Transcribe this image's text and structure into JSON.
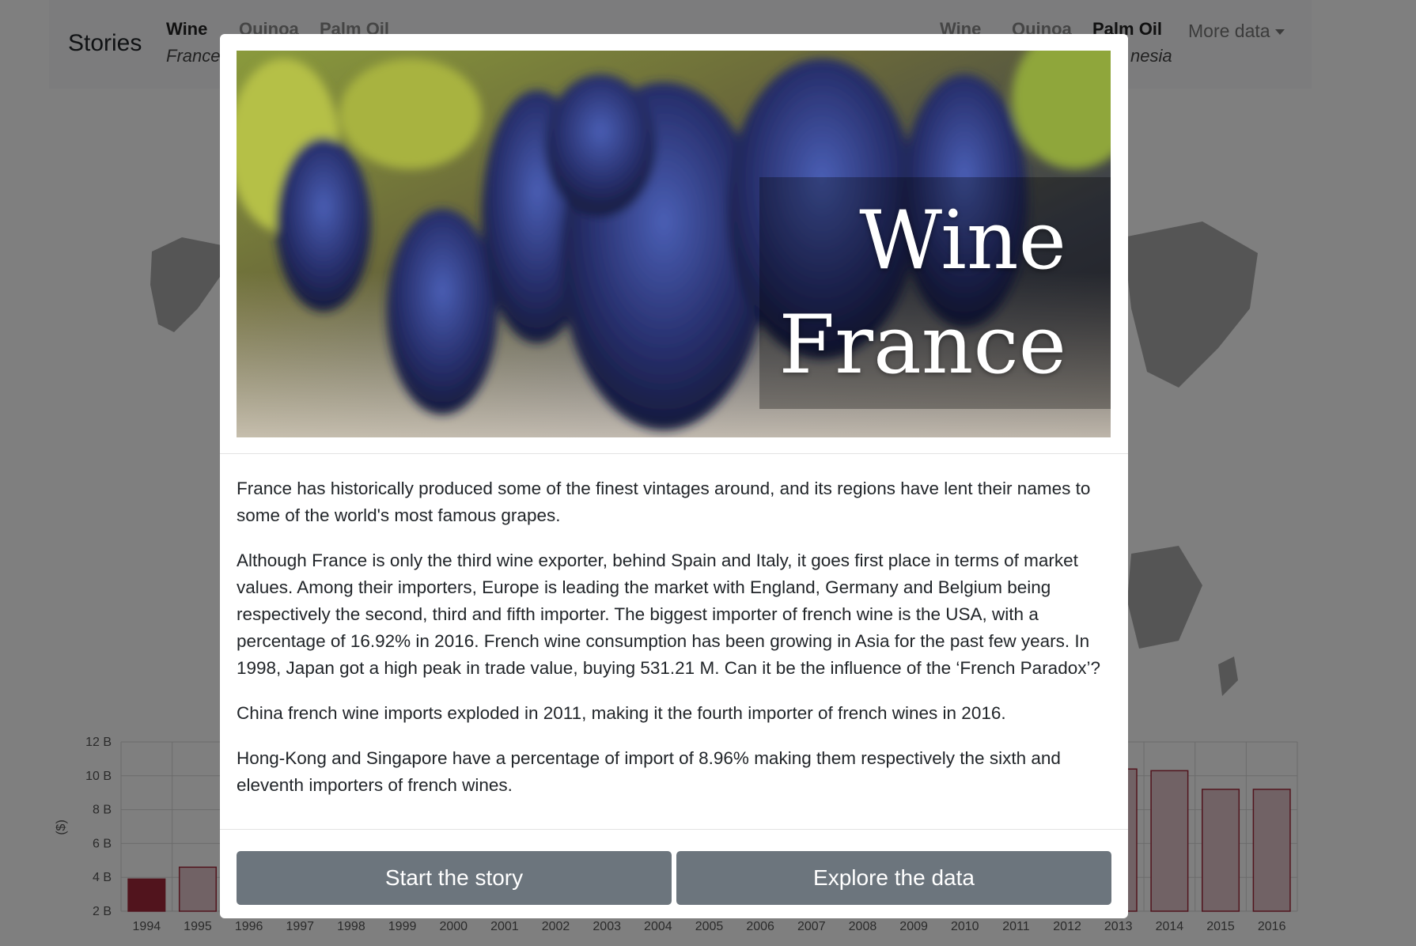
{
  "navbar": {
    "brand": "Stories",
    "stories_left": [
      {
        "product": "Wine",
        "country": "France"
      },
      {
        "product": "Quinoa",
        "country": ""
      },
      {
        "product": "Palm Oil",
        "country": ""
      }
    ],
    "stories_right": [
      {
        "product": "Wine",
        "country": ""
      },
      {
        "product": "Quinoa",
        "country": ""
      },
      {
        "product": "Palm Oil",
        "country": "nesia"
      }
    ],
    "more_data": "More data"
  },
  "modal": {
    "hero": {
      "title_product": "Wine",
      "title_country": "France"
    },
    "paragraphs": [
      "France has historically produced some of the finest vintages around, and its regions have lent their names to some of the world's most famous grapes.",
      "Although France is only the third wine exporter, behind Spain and Italy, it goes first place in terms of market values. Among their importers, Europe is leading the market with England, Germany and Belgium being respectively the second, third and fifth importer. The biggest importer of french wine is the USA, with a percentage of 16.92% in 2016. French wine consumption has been growing in Asia for the past few years. In 1998, Japan got a high peak in trade value, buying 531.21 M. Can it be the influence of the ‘French Paradox’?",
      "China french wine imports exploded in 2011, making it the fourth importer of french wines in 2016.",
      "Hong-Kong and Singapore have a percentage of import of 8.96% making them respectively the sixth and eleventh importers of french wines."
    ],
    "buttons": {
      "start": "Start the story",
      "explore": "Explore the data"
    }
  },
  "colors": {
    "bar_fill_highlight": "#a3283a",
    "bar_fill": "#e3c5ca",
    "bar_stroke": "#a3283a",
    "button": "#6c757d",
    "map_land": "#aaaaaa"
  },
  "chart_data": {
    "type": "bar",
    "ylabel": "($)",
    "ytick_labels": [
      "2 B",
      "4 B",
      "6 B",
      "8 B",
      "10 B",
      "12 B"
    ],
    "ylim": [
      2,
      12
    ],
    "categories": [
      "1994",
      "1995",
      "1996",
      "1997",
      "1998",
      "1999",
      "2000",
      "2001",
      "2002",
      "2003",
      "2004",
      "2005",
      "2006",
      "2007",
      "2008",
      "2009",
      "2010",
      "2011",
      "2012",
      "2013",
      "2014",
      "2015",
      "2016"
    ],
    "values": [
      3.9,
      4.6,
      null,
      null,
      null,
      null,
      null,
      null,
      null,
      null,
      null,
      null,
      null,
      null,
      null,
      null,
      null,
      null,
      null,
      10.4,
      10.3,
      9.2,
      9.2
    ],
    "highlighted_category": "1994",
    "grid": true
  }
}
